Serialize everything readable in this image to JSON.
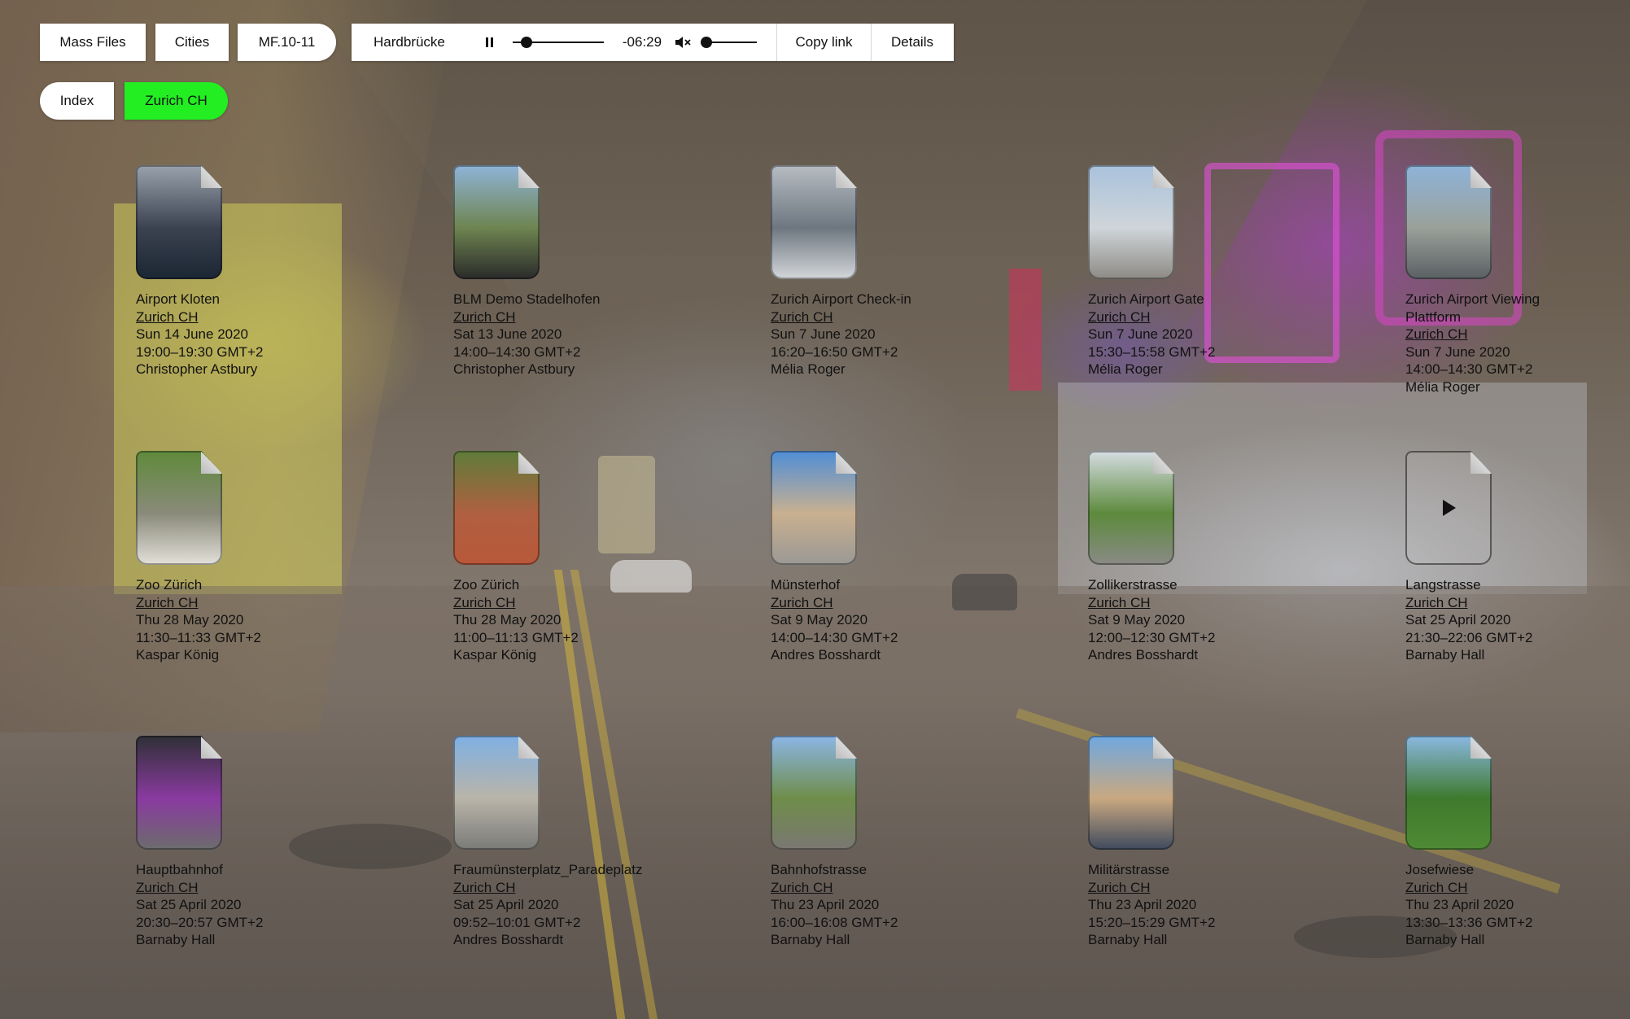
{
  "nav": {
    "mass_files": "Mass Files",
    "cities": "Cities",
    "collection": "MF.10-11",
    "index": "Index",
    "city": "Zurich CH"
  },
  "player": {
    "track": "Hardbrücke",
    "time_remaining": "-06:29",
    "seek_position": 0.15,
    "volume": 0,
    "copy_link": "Copy link",
    "details": "Details"
  },
  "colors": {
    "active_tag": "#22ee22",
    "button_bg": "#ffffff",
    "text": "#111111"
  },
  "files": [
    {
      "title": "Airport Kloten",
      "place": "Zurich CH",
      "date": "Sun 14 June 2020",
      "time": "19:00–19:30 GMT+2",
      "author": "Christopher Astbury",
      "thumb": [
        "#9aa3ad",
        "#3b4250",
        "#1b2633"
      ]
    },
    {
      "title": "BLM Demo Stadelhofen",
      "place": "Zurich CH",
      "date": "Sat 13 June 2020",
      "time": "14:00–14:30 GMT+2",
      "author": "Christopher Astbury",
      "thumb": [
        "#8fb4d8",
        "#6e8450",
        "#2a2a2a"
      ]
    },
    {
      "title": "Zurich Airport Check-in",
      "place": "Zurich CH",
      "date": "Sun 7 June 2020",
      "time": "16:20–16:50 GMT+2",
      "author": "Mélia Roger",
      "thumb": [
        "#b6bcc2",
        "#6e7780",
        "#d4d7da"
      ]
    },
    {
      "title": "Zurich Airport Gate",
      "place": "Zurich CH",
      "date": "Sun 7 June 2020",
      "time": "15:30–15:58 GMT+2",
      "author": "Mélia Roger",
      "thumb": [
        "#a9c2dc",
        "#cfd5d9",
        "#8d8a84"
      ]
    },
    {
      "title": "Zurich Airport Viewing Plattform",
      "place": "Zurich CH",
      "date": "Sun 7 June 2020",
      "time": "14:00–14:30 GMT+2",
      "author": "Mélia Roger",
      "thumb": [
        "#8eb3d9",
        "#9aa19a",
        "#5a5f63"
      ]
    },
    {
      "title": "Zoo Zürich",
      "place": "Zurich CH",
      "date": "Thu 28 May 2020",
      "time": "11:30–11:33 GMT+2",
      "author": "Kaspar König",
      "thumb": [
        "#5f8a3a",
        "#8a8a7a",
        "#e3e1d9"
      ]
    },
    {
      "title": "Zoo Zürich",
      "place": "Zurich CH",
      "date": "Thu 28 May 2020",
      "time": "11:00–11:13 GMT+2",
      "author": "Kaspar König",
      "thumb": [
        "#5e7c3a",
        "#b06040",
        "#b8583a"
      ]
    },
    {
      "title": "Münsterhof",
      "place": "Zurich CH",
      "date": "Sat 9 May 2020",
      "time": "14:00–14:30 GMT+2",
      "author": "Andres Bosshardt",
      "thumb": [
        "#4f8ed6",
        "#c9b090",
        "#9a9894"
      ]
    },
    {
      "title": "Zollikerstrasse",
      "place": "Zurich CH",
      "date": "Sat 9 May 2020",
      "time": "12:00–12:30 GMT+2",
      "author": "Andres Bosshardt",
      "thumb": [
        "#d6dde3",
        "#5d8a3c",
        "#8a8a86"
      ]
    },
    {
      "title": "Langstrasse",
      "place": "Zurich CH",
      "date": "Sat 25 April 2020",
      "time": "21:30–22:06 GMT+2",
      "author": "Barnaby Hall",
      "thumb": []
    },
    {
      "title": "Hauptbahnhof",
      "place": "Zurich CH",
      "date": "Sat 25 April 2020",
      "time": "20:30–20:57 GMT+2",
      "author": "Barnaby Hall",
      "thumb": [
        "#2e3036",
        "#8a3aa0",
        "#6c6c6c"
      ]
    },
    {
      "title": "Fraumünsterplatz_Paradeplatz",
      "place": "Zurich CH",
      "date": "Sat 25 April 2020",
      "time": "09:52–10:01 GMT+2",
      "author": "Andres Bosshardt",
      "thumb": [
        "#7fb0e3",
        "#b9b4a8",
        "#7a7a78"
      ]
    },
    {
      "title": "Bahnhofstrasse",
      "place": "Zurich CH",
      "date": "Thu 23 April 2020",
      "time": "16:00–16:08 GMT+2",
      "author": "Barnaby Hall",
      "thumb": [
        "#8bb6e6",
        "#6f8d4a",
        "#7a7772"
      ]
    },
    {
      "title": "Militärstrasse",
      "place": "Zurich CH",
      "date": "Thu 23 April 2020",
      "time": "15:20–15:29 GMT+2",
      "author": "Barnaby Hall",
      "thumb": [
        "#6fa8e0",
        "#c9a880",
        "#3f4a5e"
      ]
    },
    {
      "title": "Josefwiese",
      "place": "Zurich CH",
      "date": "Thu 23 April 2020",
      "time": "13:30–13:36 GMT+2",
      "author": "Barnaby Hall",
      "thumb": [
        "#8ab8e2",
        "#3f7a2e",
        "#4f8a34"
      ]
    }
  ]
}
